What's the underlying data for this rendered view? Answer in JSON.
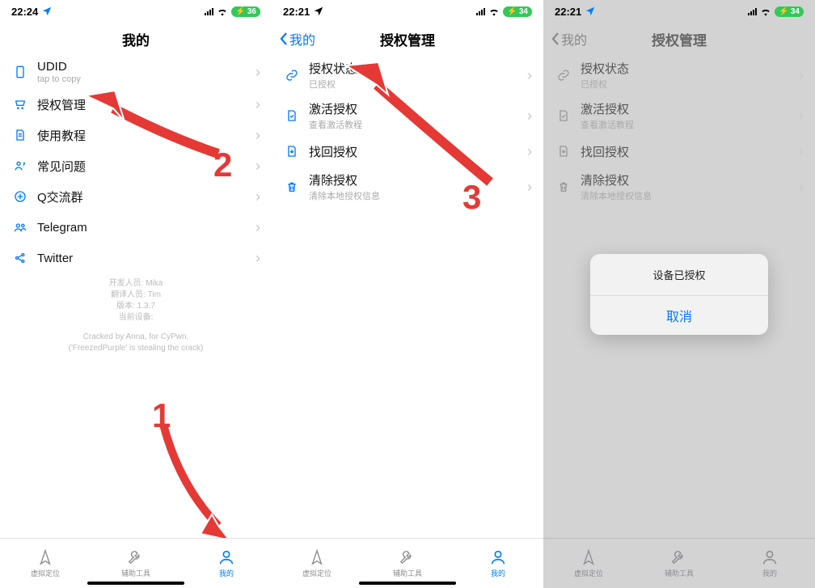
{
  "annotations": {
    "n1": "1",
    "n2": "2",
    "n3": "3"
  },
  "phone1": {
    "status": {
      "time": "22:24",
      "battery": "36"
    },
    "nav": {
      "title": "我的"
    },
    "items": [
      {
        "title": "UDID",
        "sub": "tap to copy"
      },
      {
        "title": "授权管理"
      },
      {
        "title": "使用教程"
      },
      {
        "title": "常见问题"
      },
      {
        "title": "Q交流群"
      },
      {
        "title": "Telegram"
      },
      {
        "title": "Twitter"
      }
    ],
    "info": {
      "l1": "开发人员: Mika",
      "l2": "翻译人员: Tim",
      "l3": "版本: 1.3.7",
      "l4": "当前设备:",
      "l5": "Cracked by Anna, for CyPwn.",
      "l6": "('FreezedPurple' is stealing the crack)"
    },
    "tabs": {
      "a": "虚拟定位",
      "b": "辅助工具",
      "c": "我的"
    }
  },
  "phone2": {
    "status": {
      "time": "22:21",
      "battery": "34"
    },
    "nav": {
      "back": "我的",
      "title": "授权管理"
    },
    "items": [
      {
        "title": "授权状态",
        "sub": "已授权"
      },
      {
        "title": "激活授权",
        "sub": "查看激活教程"
      },
      {
        "title": "找回授权"
      },
      {
        "title": "清除授权",
        "sub": "清除本地授权信息"
      }
    ],
    "tabs": {
      "a": "虚拟定位",
      "b": "辅助工具",
      "c": "我的"
    }
  },
  "phone3": {
    "status": {
      "time": "22:21",
      "battery": "34"
    },
    "nav": {
      "back": "我的",
      "title": "授权管理"
    },
    "items": [
      {
        "title": "授权状态",
        "sub": "已授权"
      },
      {
        "title": "激活授权",
        "sub": "查看激活教程"
      },
      {
        "title": "找回授权"
      },
      {
        "title": "清除授权",
        "sub": "清除本地授权信息"
      }
    ],
    "sheet": {
      "msg": "设备已授权",
      "cancel": "取消"
    },
    "tabs": {
      "a": "虚拟定位",
      "b": "辅助工具",
      "c": "我的"
    }
  }
}
